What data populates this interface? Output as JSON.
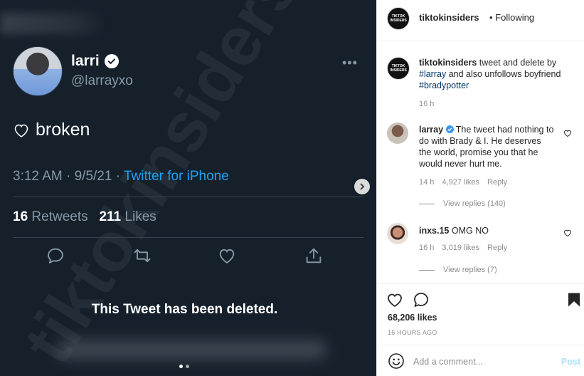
{
  "tweet": {
    "name": "larri",
    "handle": "@larrayxo",
    "more": "•••",
    "text": "broken",
    "time_prefix": "3:12 AM · 9/5/21 · ",
    "source": "Twitter for iPhone",
    "retweets_count": "16",
    "retweets_label": "Retweets",
    "likes_count": "211",
    "likes_label": "Likes",
    "deleted_notice": "This Tweet has been deleted.",
    "watermark": "tiktokinsiders"
  },
  "carousel": {
    "slides": 2,
    "active_index": 0
  },
  "post": {
    "username": "tiktokinsiders",
    "follow_status": "• Following",
    "avatar_text": "TIKTOK INSIDERS",
    "caption": {
      "username": "tiktokinsiders",
      "text_1": " tweet and delete by ",
      "tag_1": "#larray",
      "text_2": " and also unfollows boyfriend ",
      "tag_2": "#bradypotter",
      "time": "16 h"
    },
    "comments": [
      {
        "username": "larray",
        "text": " The tweet had nothing to do with Brady & I. He deserves the world, promise you that he would never hurt me.",
        "time": "14 h",
        "likes": "4,927 likes",
        "reply": "Reply",
        "view_replies": "View replies (140)"
      },
      {
        "username": "inxs.15",
        "text": " OMG NO",
        "time": "16 h",
        "likes": "3,019 likes",
        "reply": "Reply",
        "view_replies": "View replies (7)"
      }
    ],
    "likes": "68,206 likes",
    "posted_ago": "16 HOURS AGO",
    "comment_placeholder": "Add a comment...",
    "post_button": "Post"
  },
  "colors": {
    "twitter_bg": "#15202b",
    "twitter_blue": "#1da1f2",
    "ig_link": "#00376b",
    "ig_post_disabled": "#b2dffc"
  }
}
